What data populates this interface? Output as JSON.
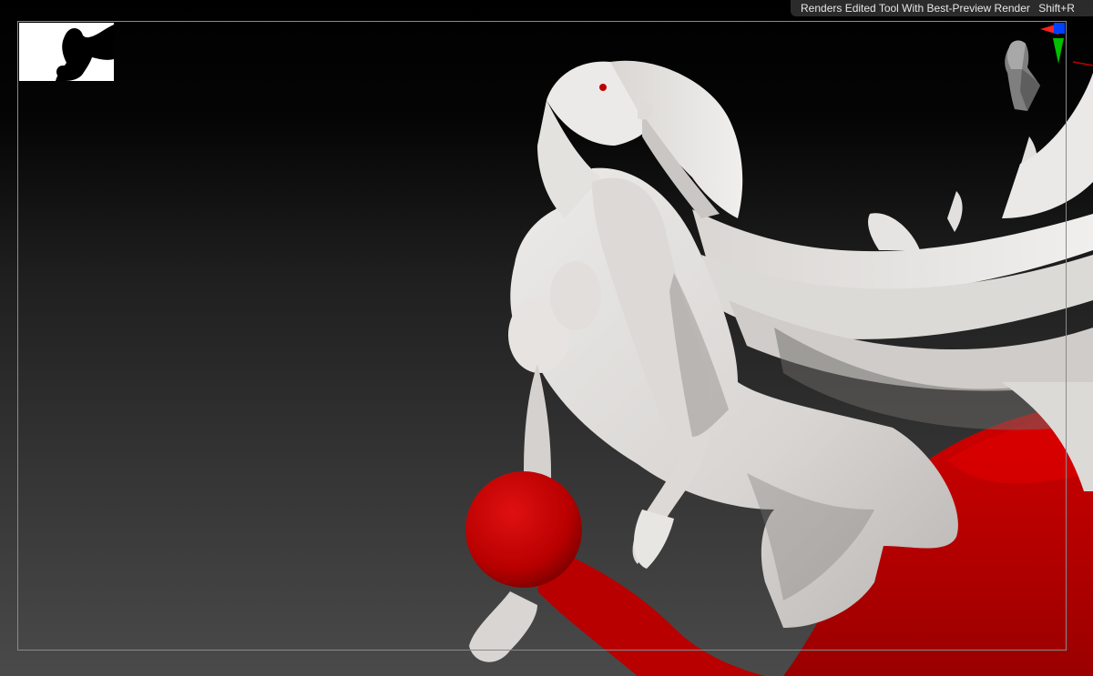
{
  "tooltip": {
    "text": "Renders Edited Tool With Best-Preview Render",
    "shortcut": "Shift+R"
  },
  "colors": {
    "background_top": "#000000",
    "background_bottom": "#4a4a4a",
    "model_skin": "#e2dfdc",
    "model_shadow": "#9a9794",
    "red_object": "#c00000",
    "frame_border": "#8a8a8a",
    "tooltip_bg": "#2b2b2b",
    "axis_x": "#ff2020",
    "axis_y": "#00c000",
    "axis_z": "#0040ff"
  },
  "icons": {
    "thumbnail": "silhouette-thumbnail-icon",
    "navigation": "head-navigation-icon",
    "axis_gizmo": "axis-gizmo-icon"
  }
}
